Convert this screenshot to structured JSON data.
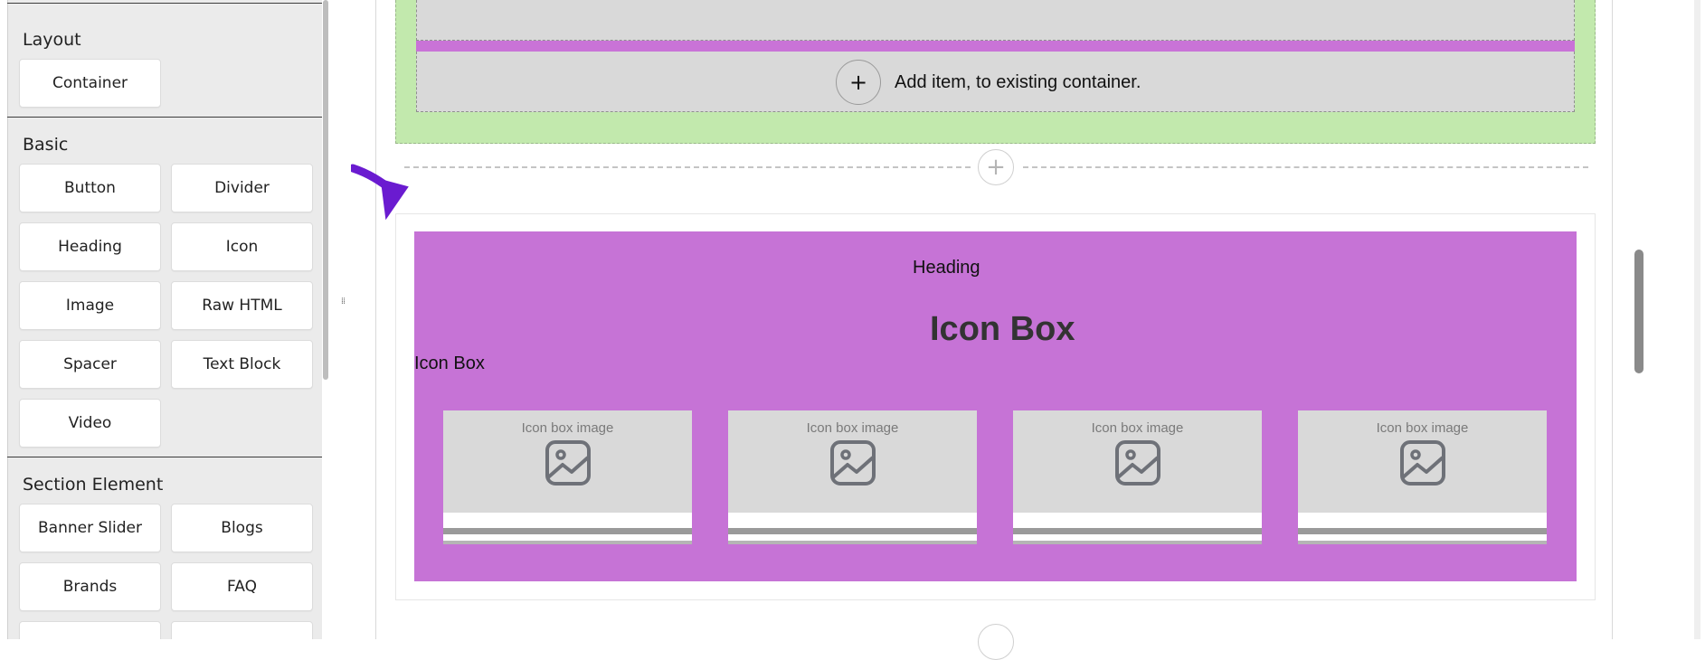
{
  "panel": {
    "sections": [
      {
        "title": "Layout",
        "items": [
          "Container"
        ]
      },
      {
        "title": "Basic",
        "items": [
          "Button",
          "Divider",
          "Heading",
          "Icon",
          "Image",
          "Raw HTML",
          "Spacer",
          "Text Block",
          "Video"
        ]
      },
      {
        "title": "Section Element",
        "items": [
          "Banner Slider",
          "Blogs",
          "Brands",
          "FAQ"
        ]
      }
    ]
  },
  "canvas": {
    "add_item_text": "Add item, to existing container.",
    "add_item_icon": "plus-icon",
    "heading_label": "Heading",
    "iconbox_title": "Icon Box",
    "iconbox_label": "Icon Box",
    "cards": [
      {
        "caption": "Icon box image"
      },
      {
        "caption": "Icon box image"
      },
      {
        "caption": "Icon box image"
      },
      {
        "caption": "Icon box image"
      }
    ]
  },
  "colors": {
    "green_container": "#c2e9ad",
    "purple_section": "#c673d6",
    "arrow": "#6a1bd0"
  }
}
